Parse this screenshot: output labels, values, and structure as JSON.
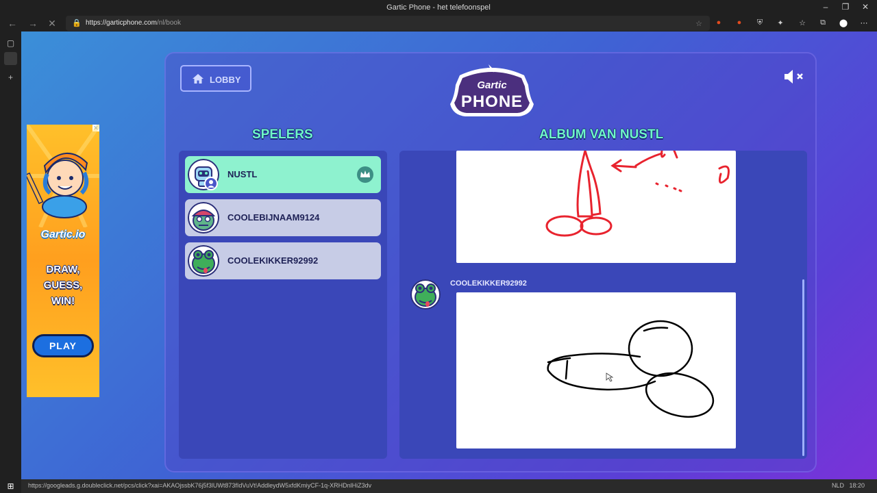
{
  "window": {
    "title": "Gartic Phone - het telefoonspel"
  },
  "browser": {
    "url_host": "https://garticphone.com",
    "url_path": "/nl/book"
  },
  "game": {
    "lobby_label": "LOBBY",
    "logo_top": "Gartic",
    "logo_bottom": "PHONE",
    "players_heading": "SPELERS",
    "album_heading": "ALBUM VAN NUSTL",
    "players": [
      {
        "name": "NUSTL"
      },
      {
        "name": "COOLEBIJNAAM9124"
      },
      {
        "name": "COOLEKIKKER92992"
      }
    ],
    "album_author": "COOLEKIKKER92992"
  },
  "ad": {
    "brand": "Gartic.io",
    "tagline_1": "DRAW,",
    "tagline_2": "GUESS,",
    "tagline_3": "WIN!",
    "play_label": "PLAY"
  },
  "statusbar": {
    "link": "https://googleads.g.doubleclick.net/pcs/click?xai=AKAOjssbK76j5f3lUWt873fIdVuVt!AddleydW5xfdKmiyCF-1q-XRHDnlHiZ3dv",
    "lang": "NLD",
    "time": "18:20"
  },
  "colors": {
    "accent": "#6ff7c8",
    "active_player": "#8ef2cf",
    "player_bg": "#c7cce6",
    "panel_inner": "#3a47b8",
    "sketch_red": "#e8232e"
  }
}
